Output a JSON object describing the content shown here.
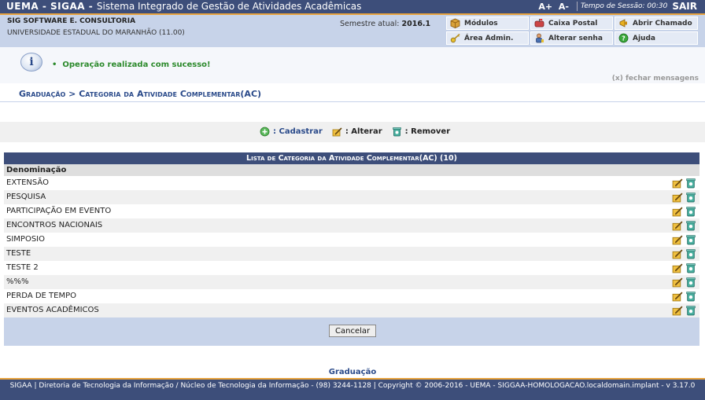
{
  "topbar": {
    "brand": "UEMA - SIGAA -",
    "subtitle": "Sistema Integrado de Gestão de Atividades Acadêmicas",
    "font_increase": "A+",
    "font_decrease": "A-",
    "session": "Tempo de Sessão: 00:30",
    "exit": "SAIR"
  },
  "info": {
    "org": "SIG SOFTWARE E. CONSULTORIA",
    "university": "UNIVERSIDADE ESTADUAL DO MARANHÃO (11.00)",
    "semester_label": "Semestre atual:",
    "semester_value": "2016.1"
  },
  "menu": {
    "modulos": "Módulos",
    "caixa_postal": "Caixa Postal",
    "abrir_chamado": "Abrir Chamado",
    "area_admin": "Área Admin.",
    "alterar_senha": "Alterar senha",
    "ajuda": "Ajuda"
  },
  "message": {
    "bullet": "•",
    "text": "Operação realizada com sucesso!",
    "close": "(x) fechar mensagens"
  },
  "breadcrumb": "Graduação > Categoria da Atividade Complementar(AC)",
  "actions": {
    "cadastrar": ": Cadastrar",
    "alterar": ": Alterar",
    "remover": ": Remover"
  },
  "table": {
    "caption": "Lista de Categoria da Atividade Complementar(AC) (10)",
    "header": "Denominação",
    "rows": [
      "EXTENSÃO",
      "PESQUISA",
      "PARTICIPAÇÃO EM EVENTO",
      "ENCONTROS NACIONAIS",
      "SIMPOSIO",
      "TESTE",
      "TESTE 2",
      "%%%",
      "PERDA DE TEMPO",
      "EVENTOS ACADÊMICOS"
    ],
    "cancel": "Cancelar"
  },
  "footer": {
    "link": "Graduação",
    "text": "SIGAA | Diretoria de Tecnologia da Informação / Núcleo de Tecnologia da Informação - (98) 3244-1128 | Copyright © 2006-2016 - UEMA - SIGGAA-HOMOLOGACAO.localdomain.implant - v 3.17.0"
  },
  "colors": {
    "primary": "#3d4e7a",
    "accent": "#e8a33d",
    "info_bg": "#c7d3e9",
    "success": "#2c8a2c"
  },
  "icons": {
    "modulos": "cube-icon",
    "caixa_postal": "mailbox-icon",
    "abrir_chamado": "megaphone-icon",
    "area_admin": "key-icon",
    "alterar_senha": "user-key-icon",
    "ajuda": "help-icon",
    "cadastrar": "add-icon",
    "alterar": "edit-icon",
    "remover": "trash-icon",
    "message": "info-icon"
  }
}
